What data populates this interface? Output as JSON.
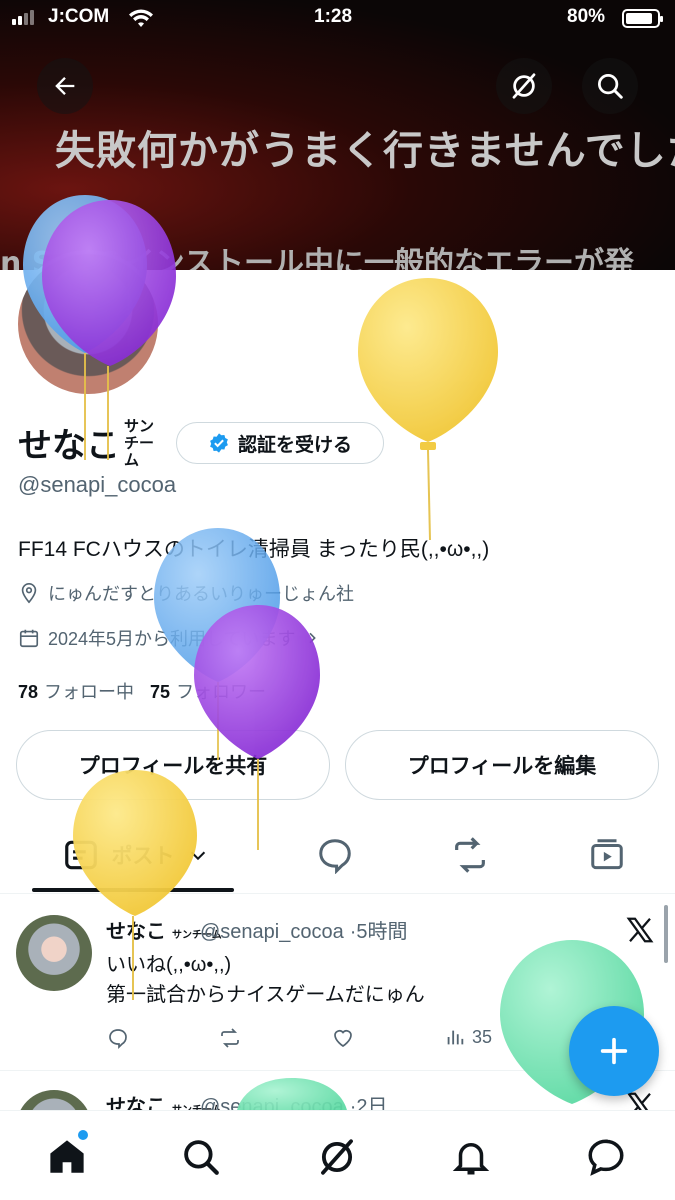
{
  "status_bar": {
    "carrier": "J:COM",
    "time": "1:28",
    "battery": "80%",
    "battery_level": 0.8
  },
  "banner": {
    "line1": "失敗何かがうまく行きませんでした。",
    "line2": "n S         e のインストール中に一般的なエラーが発"
  },
  "header_buttons": {
    "back": "arrow-left-icon",
    "grok": "grok-icon",
    "search": "search-icon"
  },
  "profile": {
    "name": "せなこ",
    "name_suffix": "サンチーム",
    "verify_label": "認証を受ける",
    "handle": "@senapi_cocoa",
    "bio": "FF14 FCハウスのトイレ清掃員 まったり民(,,•ω•,,)",
    "location": "にゅんだすとりあるいりゅーじょん社",
    "joined": "2024年5月から利用しています",
    "following_count": "78",
    "following_label": "フォロー中",
    "followers_count": "75",
    "followers_label": "フォロワー"
  },
  "actions": {
    "share": "プロフィールを共有",
    "edit": "プロフィールを編集"
  },
  "tabs": {
    "posts": "ポスト"
  },
  "tweets": [
    {
      "name": "せなこ",
      "name_suffix": "サンチーム",
      "handle": "@senapi_cocoa",
      "time": "·5時間",
      "text1": "いいね(,,•ω•,,)",
      "text2": "第一試合からナイスゲームだにゅん",
      "views": "35"
    },
    {
      "name": "せなこ",
      "name_suffix": "サンチーム",
      "handle": "@senapi_cocoa",
      "time": "·2日"
    }
  ],
  "colors": {
    "accent": "#1d9bf0",
    "verified": "#1d9bf0",
    "balloon_yellow": "#f5d04a",
    "balloon_purple": "#9b3fe0",
    "balloon_blue": "#5aa7f0",
    "balloon_green": "#6fe3b2"
  }
}
